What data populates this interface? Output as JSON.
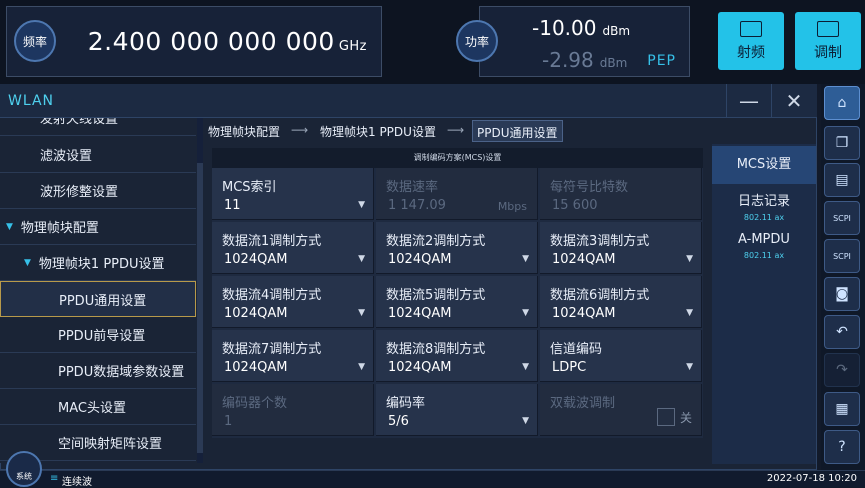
{
  "freq": {
    "label": "频率",
    "value": "2.400 000 000 000",
    "unit": "GHz"
  },
  "power": {
    "label": "功率",
    "value": "-10.00",
    "unit": "dBm",
    "pep_value": "-2.98",
    "pep_unit": "dBm",
    "pep_label": "PEP"
  },
  "top_buttons": {
    "rf": "射频",
    "mod": "调制"
  },
  "window": {
    "title": "WLAN",
    "min": "—",
    "close": "✕"
  },
  "tree": [
    {
      "label": "发射天线设置"
    },
    {
      "label": "滤波设置"
    },
    {
      "label": "波形修整设置"
    },
    {
      "label": "物理帧块配置"
    },
    {
      "label": "物理帧块1 PPDU设置"
    },
    {
      "label": "PPDU通用设置"
    },
    {
      "label": "PPDU前导设置"
    },
    {
      "label": "PPDU数据域参数设置"
    },
    {
      "label": "MAC头设置"
    },
    {
      "label": "空间映射矩阵设置"
    }
  ],
  "breadcrumb": {
    "c1": "物理帧块配置",
    "c2": "物理帧块1 PPDU设置",
    "c3": "PPDU通用设置",
    "sep": "⟶"
  },
  "panel": {
    "title": "调制编码方案(MCS)设置"
  },
  "cells": [
    {
      "label": "MCS索引",
      "value": "11"
    },
    {
      "label": "数据速率",
      "value": "1 147.09",
      "unit": "Mbps"
    },
    {
      "label": "每符号比特数",
      "value": "15 600"
    },
    {
      "label": "数据流1调制方式",
      "value": "1024QAM"
    },
    {
      "label": "数据流2调制方式",
      "value": "1024QAM"
    },
    {
      "label": "数据流3调制方式",
      "value": "1024QAM"
    },
    {
      "label": "数据流4调制方式",
      "value": "1024QAM"
    },
    {
      "label": "数据流5调制方式",
      "value": "1024QAM"
    },
    {
      "label": "数据流6调制方式",
      "value": "1024QAM"
    },
    {
      "label": "数据流7调制方式",
      "value": "1024QAM"
    },
    {
      "label": "数据流8调制方式",
      "value": "1024QAM"
    },
    {
      "label": "信道编码",
      "value": "LDPC"
    },
    {
      "label": "编码器个数",
      "value": "1"
    },
    {
      "label": "编码率",
      "value": "5/6"
    },
    {
      "label": "双载波调制",
      "value": "关"
    }
  ],
  "side": {
    "s1": "MCS设置",
    "s2": "日志记录",
    "s2sub": "802.11 ax",
    "s3": "A-MPDU",
    "s3sub": "802.11 ax"
  },
  "status": {
    "sys": "系统",
    "mode": "连续波",
    "datetime": "2022-07-18 10:20"
  }
}
